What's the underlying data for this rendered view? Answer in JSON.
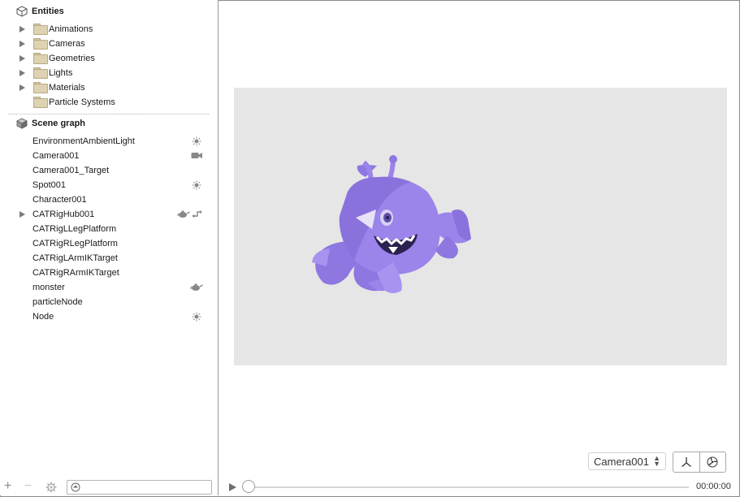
{
  "entities": {
    "title": "Entities",
    "icon": "cube-outline-icon",
    "items": [
      {
        "label": "Animations",
        "expandable": true
      },
      {
        "label": "Cameras",
        "expandable": true
      },
      {
        "label": "Geometries",
        "expandable": true
      },
      {
        "label": "Lights",
        "expandable": true
      },
      {
        "label": "Materials",
        "expandable": true
      },
      {
        "label": "Particle Systems",
        "expandable": false
      }
    ]
  },
  "scene_graph": {
    "title": "Scene graph",
    "icon": "cube-solid-icon",
    "nodes": [
      {
        "label": "EnvironmentAmbientLight",
        "icons": [
          "light-icon"
        ]
      },
      {
        "label": "Camera001",
        "icons": [
          "camera-icon"
        ]
      },
      {
        "label": "Camera001_Target",
        "icons": []
      },
      {
        "label": "Spot001",
        "icons": [
          "light-icon"
        ]
      },
      {
        "label": "Character001",
        "icons": []
      },
      {
        "label": "CATRigHub001",
        "icons": [
          "geometry-teapot-icon",
          "skinner-icon"
        ],
        "expandable": true
      },
      {
        "label": "CATRigLLegPlatform",
        "icons": []
      },
      {
        "label": "CATRigRLegPlatform",
        "icons": []
      },
      {
        "label": "CATRigLArmIKTarget",
        "icons": []
      },
      {
        "label": "CATRigRArmIKTarget",
        "icons": []
      },
      {
        "label": "monster",
        "icons": [
          "geometry-teapot-icon"
        ]
      },
      {
        "label": "particleNode",
        "icons": []
      },
      {
        "label": "Node",
        "icons": [
          "light-icon"
        ]
      }
    ]
  },
  "bottom_bar": {
    "add": "+",
    "remove": "−",
    "settings_icon": "gear-icon",
    "filter_icon": "filter-icon",
    "filter_value": ""
  },
  "viewport": {
    "camera": "Camera001",
    "mode_icons": [
      "axes-icon",
      "fan-icon"
    ],
    "time": "00:00:00",
    "colors": {
      "background": "#e6e6e6",
      "monster": "#9b84ea"
    }
  }
}
